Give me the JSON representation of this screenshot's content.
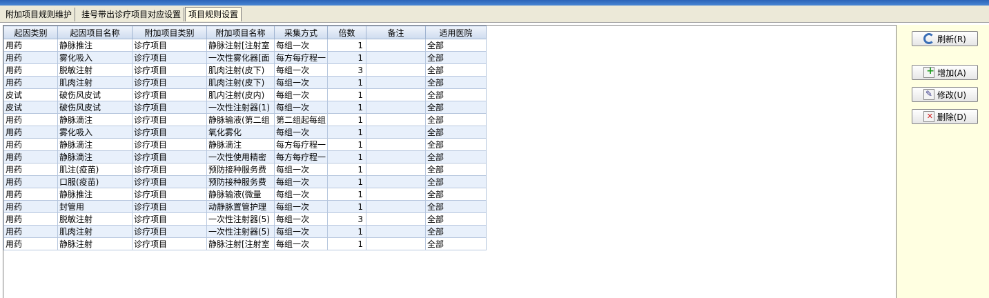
{
  "tabs": [
    {
      "label": "附加项目规则维护"
    },
    {
      "label": "挂号带出诊疗项目对应设置"
    },
    {
      "label": "项目规则设置"
    }
  ],
  "grid": {
    "columns": [
      "起因类别",
      "起因项目名称",
      "附加项目类别",
      "附加项目名称",
      "采集方式",
      "倍数",
      "备注",
      "适用医院"
    ],
    "rows": [
      [
        "用药",
        "静脉推注",
        "诊疗项目",
        "静脉注射[注射室",
        "每组一次",
        "1",
        "",
        "全部"
      ],
      [
        "用药",
        "雾化吸入",
        "诊疗项目",
        "一次性雾化器[面",
        "每方每疗程一",
        "1",
        "",
        "全部"
      ],
      [
        "用药",
        "脱敏注射",
        "诊疗项目",
        "肌肉注射(皮下)",
        "每组一次",
        "3",
        "",
        "全部"
      ],
      [
        "用药",
        "肌肉注射",
        "诊疗项目",
        "肌肉注射(皮下)",
        "每组一次",
        "1",
        "",
        "全部"
      ],
      [
        "皮试",
        "破伤风皮试",
        "诊疗项目",
        "肌内注射(皮内)",
        "每组一次",
        "1",
        "",
        "全部"
      ],
      [
        "皮试",
        "破伤风皮试",
        "诊疗项目",
        "一次性注射器(1)",
        "每组一次",
        "1",
        "",
        "全部"
      ],
      [
        "用药",
        "静脉滴注",
        "诊疗项目",
        "静脉输液(第二组",
        "第二组起每组",
        "1",
        "",
        "全部"
      ],
      [
        "用药",
        "雾化吸入",
        "诊疗项目",
        "氧化雾化",
        "每组一次",
        "1",
        "",
        "全部"
      ],
      [
        "用药",
        "静脉滴注",
        "诊疗项目",
        "静脉滴注",
        "每方每疗程一",
        "1",
        "",
        "全部"
      ],
      [
        "用药",
        "静脉滴注",
        "诊疗项目",
        "一次性使用精密",
        "每方每疗程一",
        "1",
        "",
        "全部"
      ],
      [
        "用药",
        "肌注(疫苗)",
        "诊疗项目",
        "预防接种服务费",
        "每组一次",
        "1",
        "",
        "全部"
      ],
      [
        "用药",
        "口服(疫苗)",
        "诊疗项目",
        "预防接种服务费",
        "每组一次",
        "1",
        "",
        "全部"
      ],
      [
        "用药",
        "静脉推注",
        "诊疗项目",
        "静脉输液(微量",
        "每组一次",
        "1",
        "",
        "全部"
      ],
      [
        "用药",
        "封管用",
        "诊疗项目",
        "动静脉置管护理",
        "每组一次",
        "1",
        "",
        "全部"
      ],
      [
        "用药",
        "脱敏注射",
        "诊疗项目",
        "一次性注射器(5)",
        "每组一次",
        "3",
        "",
        "全部"
      ],
      [
        "用药",
        "肌肉注射",
        "诊疗项目",
        "一次性注射器(5)",
        "每组一次",
        "1",
        "",
        "全部"
      ],
      [
        "用药",
        "静脉注射",
        "诊疗项目",
        "静脉注射[注射室",
        "每组一次",
        "1",
        "",
        "全部"
      ]
    ]
  },
  "buttons": {
    "refresh": "刷新(R)",
    "add": "增加(A)",
    "edit": "修改(U)",
    "delete": "删除(D)"
  },
  "icons": {
    "refresh": "refresh-icon",
    "add": "add-icon",
    "edit": "edit-icon",
    "delete": "delete-icon"
  },
  "colors": {
    "row_alt": "#e8f0fb",
    "pane_bg": "#ffffe1",
    "header_blue": "#2b63b8"
  }
}
